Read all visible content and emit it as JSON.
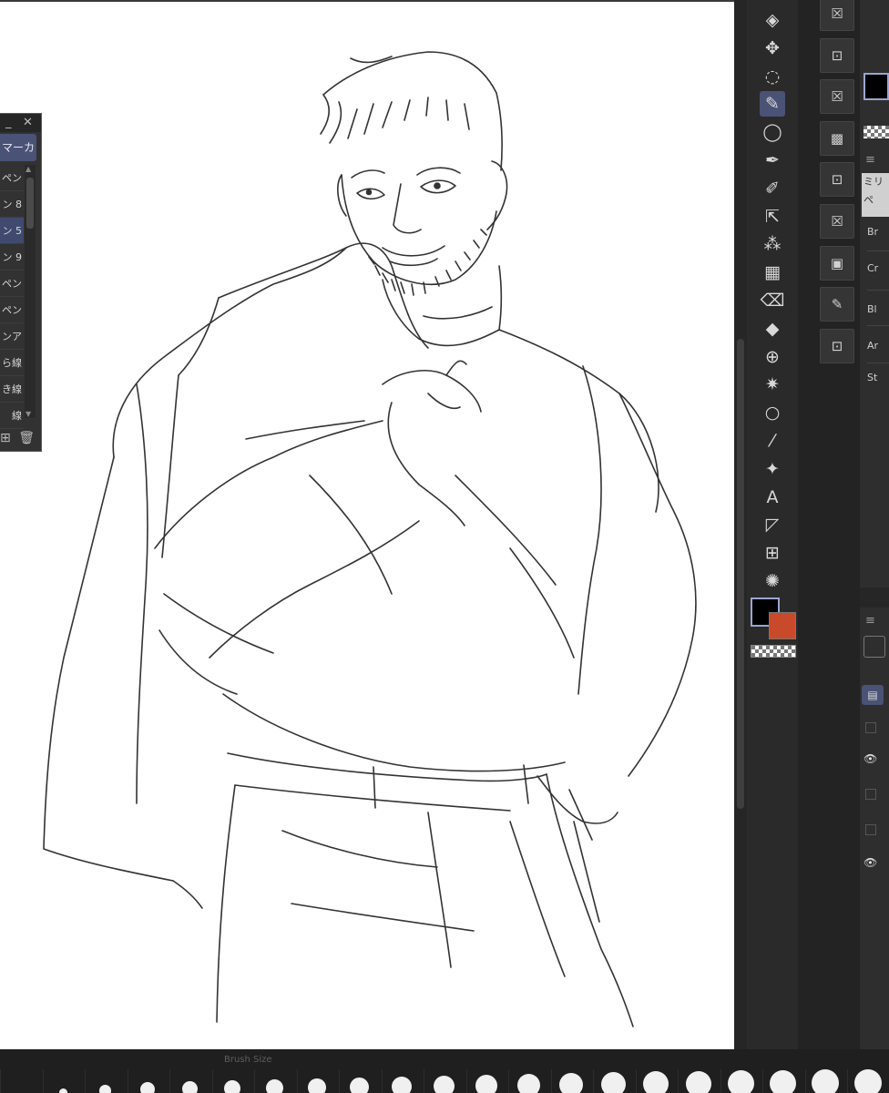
{
  "brush_palette": {
    "tab_label": "マーカ",
    "items": [
      {
        "label": "ペン",
        "selected": false
      },
      {
        "label": "ン 8",
        "selected": false
      },
      {
        "label": "ン 5",
        "selected": true
      },
      {
        "label": "ン 9",
        "selected": false
      },
      {
        "label": "ペン",
        "selected": false
      },
      {
        "label": "ペン",
        "selected": false
      },
      {
        "label": "ンア",
        "selected": false
      },
      {
        "label": "ら線",
        "selected": false
      },
      {
        "label": "き線",
        "selected": false
      },
      {
        "label": "線",
        "selected": false
      }
    ],
    "close_glyph": "✕",
    "minimize_glyph": "_"
  },
  "tools": [
    {
      "name": "layer-move-icon",
      "glyph": "◈"
    },
    {
      "name": "move-icon",
      "glyph": "✥"
    },
    {
      "name": "rotate-icon",
      "glyph": "◌"
    },
    {
      "name": "pen-icon",
      "glyph": "✎",
      "active": true
    },
    {
      "name": "lasso-icon",
      "glyph": "◯"
    },
    {
      "name": "eyedropper-icon",
      "glyph": "✒"
    },
    {
      "name": "brush-icon",
      "glyph": "✐"
    },
    {
      "name": "select-arrow-icon",
      "glyph": "⇱"
    },
    {
      "name": "airbrush-icon",
      "glyph": "⁂"
    },
    {
      "name": "gradient-icon",
      "glyph": "▦"
    },
    {
      "name": "eraser-icon",
      "glyph": "⌫"
    },
    {
      "name": "fill-icon",
      "glyph": "◆"
    },
    {
      "name": "mesh-icon",
      "glyph": "⊕"
    },
    {
      "name": "sparkle-icon",
      "glyph": "✷"
    },
    {
      "name": "ellipse-icon",
      "glyph": "○"
    },
    {
      "name": "pipette-icon",
      "glyph": "⁄"
    },
    {
      "name": "star-icon",
      "glyph": "✦"
    },
    {
      "name": "text-icon",
      "glyph": "A"
    },
    {
      "name": "frame-icon",
      "glyph": "◸"
    },
    {
      "name": "panel-icon",
      "glyph": "⊞"
    },
    {
      "name": "burst-icon",
      "glyph": "✺"
    }
  ],
  "colors": {
    "main": "#000000",
    "sub": "#c94a2a"
  },
  "commands": [
    {
      "name": "clear-icon",
      "glyph": "☒"
    },
    {
      "name": "layer-lock-icon",
      "glyph": "⊡"
    },
    {
      "name": "clear-icon",
      "glyph": "☒"
    },
    {
      "name": "transparent-icon",
      "glyph": "▩"
    },
    {
      "name": "layer-icon",
      "glyph": "⊡"
    },
    {
      "name": "clear-icon",
      "glyph": "☒"
    },
    {
      "name": "image-icon",
      "glyph": "▣"
    },
    {
      "name": "edit-icon",
      "glyph": "✎"
    },
    {
      "name": "layer-lock-icon",
      "glyph": "⊡"
    }
  ],
  "right_panel": {
    "brush_name": "ミリペ",
    "props": [
      "Br",
      "Cr",
      "Bl",
      "Ar",
      "St"
    ]
  },
  "brush_size": {
    "title": "Brush Size",
    "dots": [
      4,
      9,
      13,
      16,
      17,
      18,
      19,
      20,
      21,
      22,
      23,
      24,
      25,
      26,
      27,
      28,
      28,
      29,
      29,
      30,
      30,
      30
    ]
  }
}
